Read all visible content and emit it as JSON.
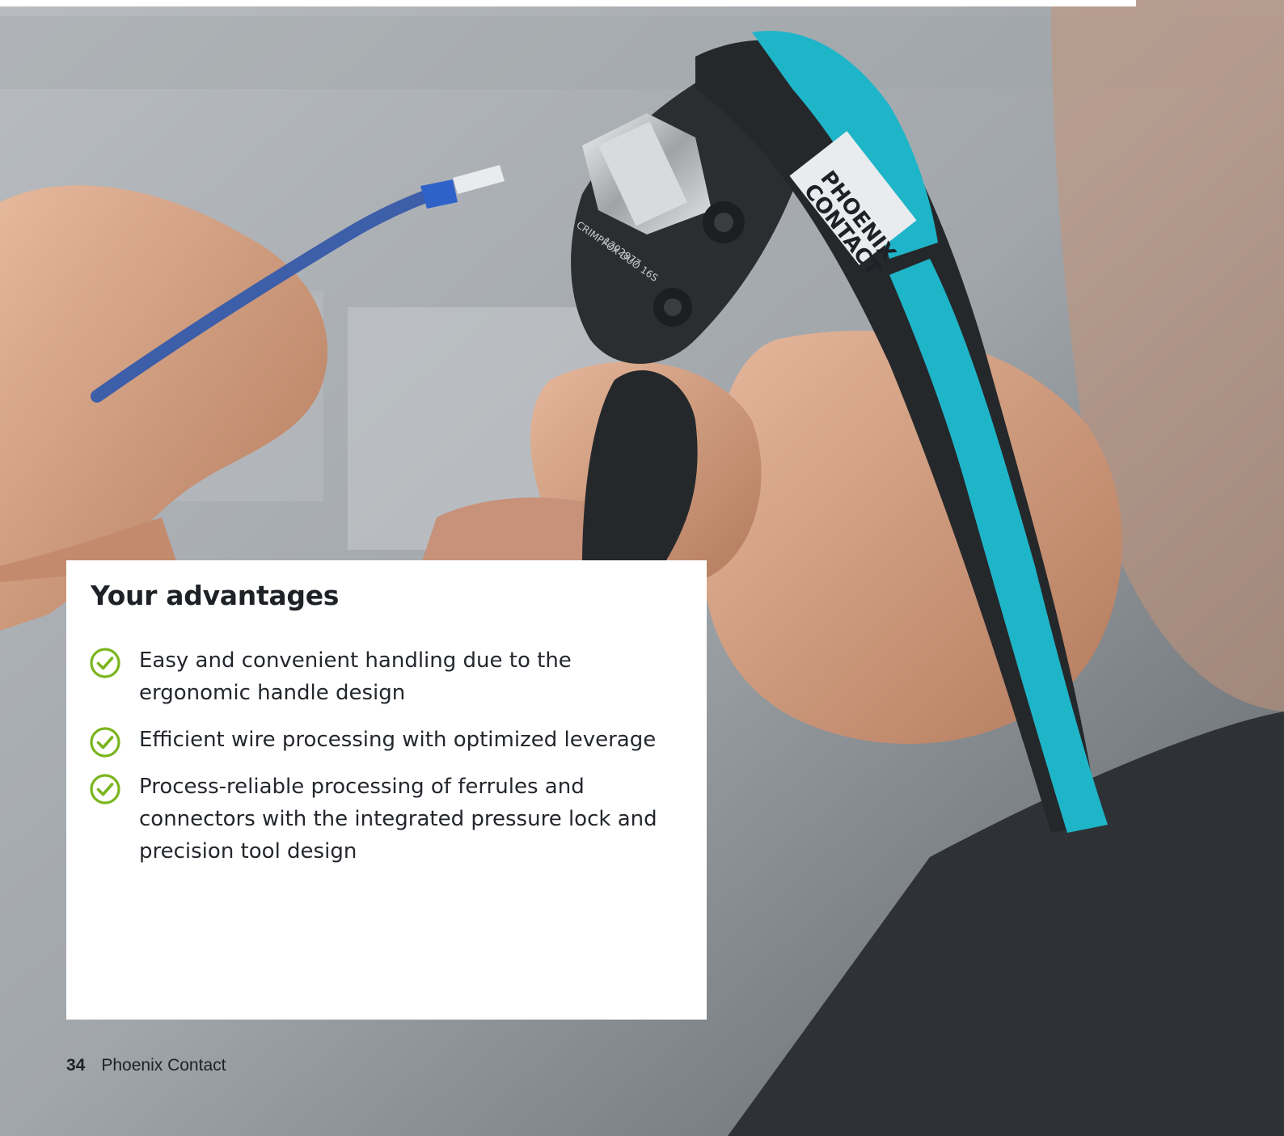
{
  "card": {
    "title": "Your advantages",
    "items": [
      "Easy and convenient handling due to the ergonomic handle design",
      "Efficient wire processing with optimized leverage",
      "Process-reliable processing of ferrules and connectors with the integrated pressure lock and precision tool design"
    ]
  },
  "footer": {
    "page_number": "34",
    "company": "Phoenix Contact"
  },
  "photo": {
    "tool_print": "CRIMPFOX DUO 16S",
    "tool_article": "1202877",
    "brand_logo": "PHOENIX CONTACT"
  },
  "colors": {
    "check": "#7ab51d",
    "tool_accent": "#1fb5c8",
    "text": "#1e2227"
  },
  "icons": {
    "check": "check-circle-icon"
  }
}
